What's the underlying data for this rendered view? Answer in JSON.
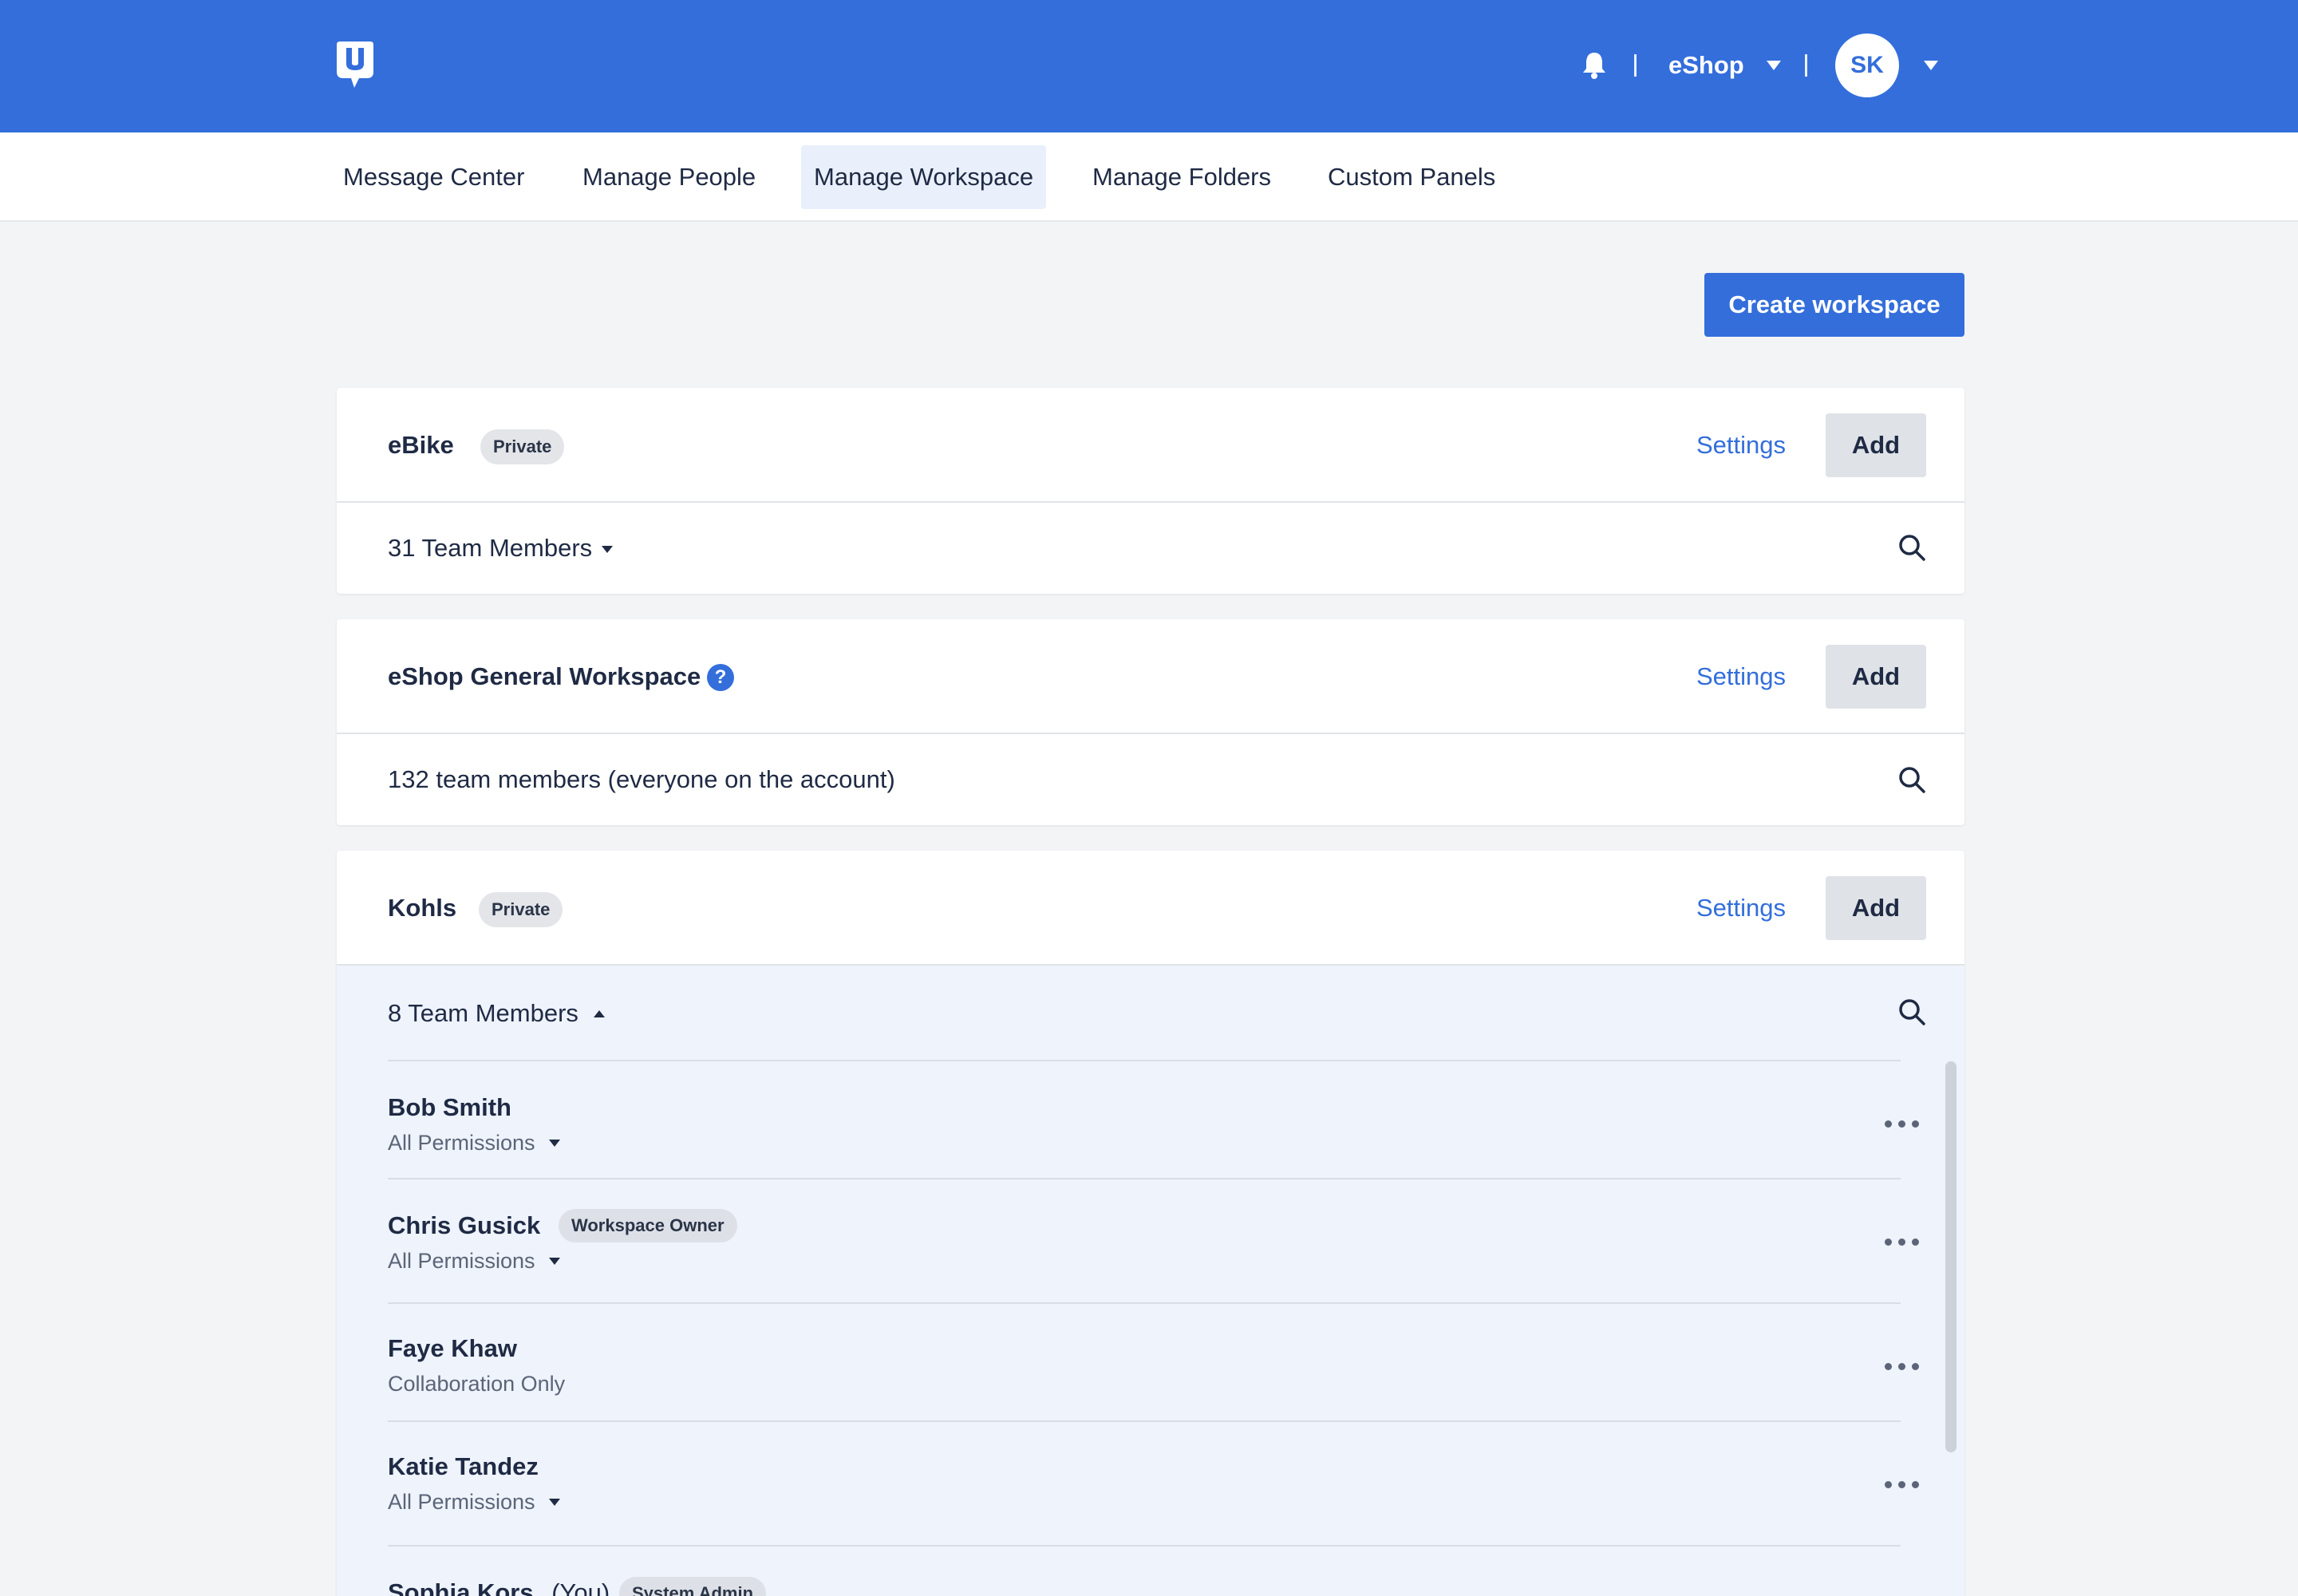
{
  "header": {
    "account_name": "eShop",
    "avatar_initials": "SK",
    "brand_color": "#336edb"
  },
  "nav": {
    "tabs": [
      {
        "label": "Message Center",
        "active": false
      },
      {
        "label": "Manage People",
        "active": false
      },
      {
        "label": "Manage Workspace",
        "active": true
      },
      {
        "label": "Manage Folders",
        "active": false
      },
      {
        "label": "Custom Panels",
        "active": false
      }
    ]
  },
  "actions": {
    "create_workspace": "Create workspace"
  },
  "workspaces": [
    {
      "name": "eBike",
      "badge": "Private",
      "settings_label": "Settings",
      "add_label": "Add",
      "members_label": "31 Team Members"
    },
    {
      "name": "eShop General Workspace",
      "help_icon": "question-circle-icon",
      "settings_label": "Settings",
      "add_label": "Add",
      "members_label": "132 team members (everyone on the account)"
    },
    {
      "name": "Kohls",
      "badge": "Private",
      "settings_label": "Settings",
      "add_label": "Add",
      "members_label": "8 Team Members",
      "members": [
        {
          "name": "Bob Smith",
          "permission": "All Permissions"
        },
        {
          "name": "Chris Gusick",
          "badge": "Workspace Owner",
          "permission": "All Permissions"
        },
        {
          "name": "Faye Khaw",
          "permission": "Collaboration Only"
        },
        {
          "name": "Katie Tandez",
          "permission": "All Permissions"
        },
        {
          "name": "Sophia Kors",
          "you": "(You)",
          "badge": "System Admin"
        }
      ]
    }
  ]
}
